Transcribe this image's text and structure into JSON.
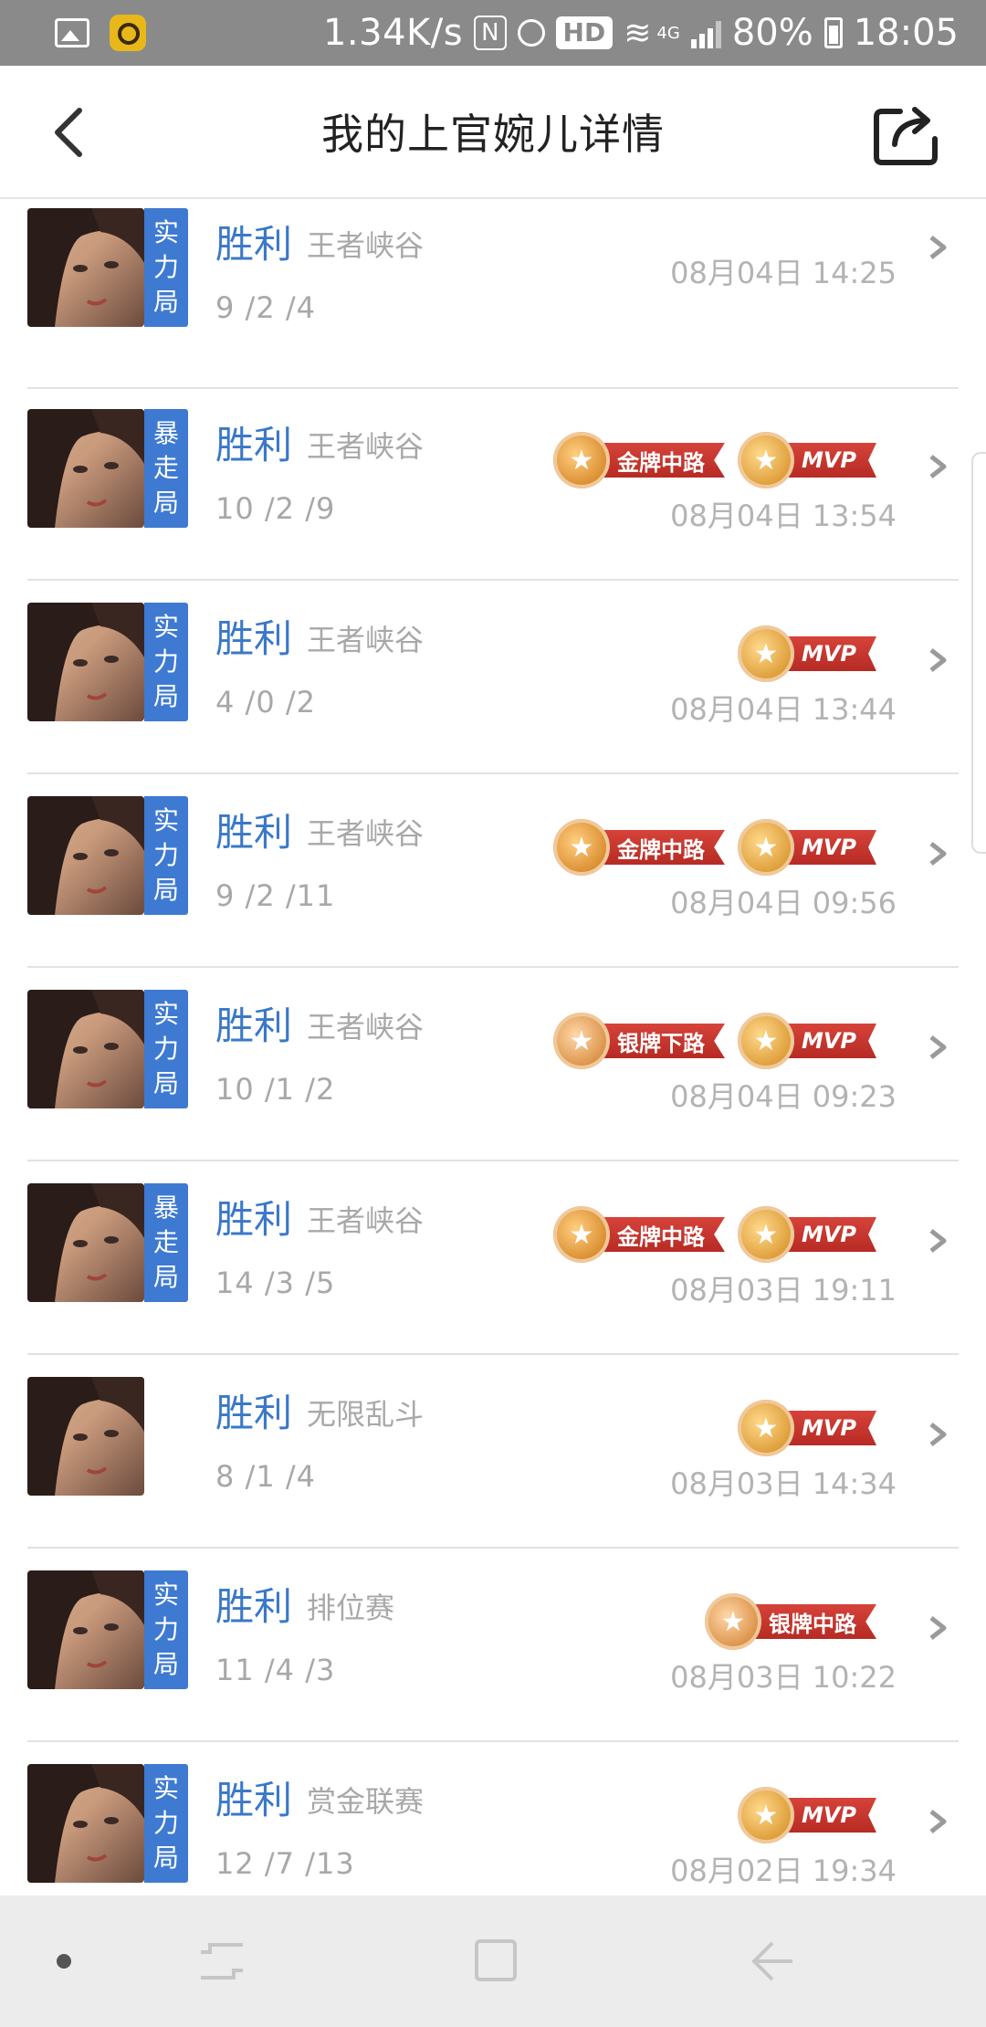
{
  "status_bar": {
    "speed": "1.34K/s",
    "nfc": "N",
    "hd": "HD",
    "network": "4G",
    "battery": "80%",
    "time": "18:05"
  },
  "header": {
    "title": "我的上官婉儿详情"
  },
  "colors": {
    "accent_blue": "#3e7ad1",
    "result_blue": "#3a78c8",
    "badge_red": "#c0352e"
  },
  "matches": [
    {
      "mode_tag": [
        "实",
        "力",
        "局"
      ],
      "result": "胜利",
      "map": "王者峡谷",
      "kda": "9 /2 /4",
      "time": "08月04日 14:25",
      "badges": []
    },
    {
      "mode_tag": [
        "暴",
        "走",
        "局"
      ],
      "result": "胜利",
      "map": "王者峡谷",
      "kda": "10 /2 /9",
      "time": "08月04日 13:54",
      "badges": [
        {
          "type": "gold",
          "label": "金牌中路"
        },
        {
          "type": "mvp",
          "label": "MVP"
        }
      ]
    },
    {
      "mode_tag": [
        "实",
        "力",
        "局"
      ],
      "result": "胜利",
      "map": "王者峡谷",
      "kda": "4 /0 /2",
      "time": "08月04日 13:44",
      "badges": [
        {
          "type": "mvp",
          "label": "MVP"
        }
      ]
    },
    {
      "mode_tag": [
        "实",
        "力",
        "局"
      ],
      "result": "胜利",
      "map": "王者峡谷",
      "kda": "9 /2 /11",
      "time": "08月04日 09:56",
      "badges": [
        {
          "type": "gold",
          "label": "金牌中路"
        },
        {
          "type": "mvp",
          "label": "MVP"
        }
      ]
    },
    {
      "mode_tag": [
        "实",
        "力",
        "局"
      ],
      "result": "胜利",
      "map": "王者峡谷",
      "kda": "10 /1 /2",
      "time": "08月04日 09:23",
      "badges": [
        {
          "type": "silver",
          "label": "银牌下路"
        },
        {
          "type": "mvp",
          "label": "MVP"
        }
      ]
    },
    {
      "mode_tag": [
        "暴",
        "走",
        "局"
      ],
      "result": "胜利",
      "map": "王者峡谷",
      "kda": "14 /3 /5",
      "time": "08月03日 19:11",
      "badges": [
        {
          "type": "gold",
          "label": "金牌中路"
        },
        {
          "type": "mvp",
          "label": "MVP"
        }
      ]
    },
    {
      "mode_tag": [],
      "result": "胜利",
      "map": "无限乱斗",
      "kda": "8 /1 /4",
      "time": "08月03日 14:34",
      "badges": [
        {
          "type": "mvp",
          "label": "MVP"
        }
      ]
    },
    {
      "mode_tag": [
        "实",
        "力",
        "局"
      ],
      "result": "胜利",
      "map": "排位赛",
      "kda": "11 /4 /3",
      "time": "08月03日 10:22",
      "badges": [
        {
          "type": "silver",
          "label": "银牌中路"
        }
      ]
    },
    {
      "mode_tag": [
        "实",
        "力",
        "局"
      ],
      "result": "胜利",
      "map": "赏金联赛",
      "kda": "12 /7 /13",
      "time": "08月02日 19:34",
      "badges": [
        {
          "type": "mvp",
          "label": "MVP"
        }
      ]
    }
  ],
  "icons": {
    "back": "chevron-left-icon",
    "share": "share-icon",
    "row_arrow": "chevron-right-icon"
  }
}
